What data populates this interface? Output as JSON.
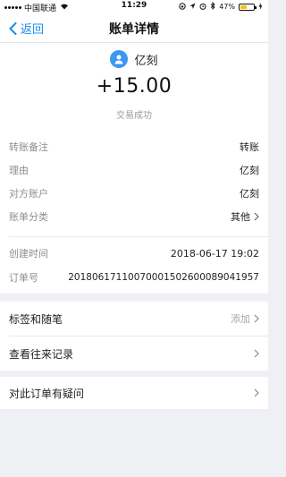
{
  "status_bar": {
    "carrier": "中国联通",
    "time": "11:29",
    "battery_percent": "47%",
    "battery_level": 0.47,
    "icons": [
      "signal-dots-icon",
      "wifi-icon",
      "lock-rotation-icon",
      "location-icon",
      "alarm-icon",
      "bluetooth-icon",
      "battery-icon",
      "charging-icon"
    ]
  },
  "nav": {
    "back_label": "返回",
    "title": "账单详情"
  },
  "summary": {
    "payee_name": "亿刻",
    "amount": "+15.00",
    "status": "交易成功",
    "avatar_color": "#3b97ef"
  },
  "details": [
    {
      "label": "转账备注",
      "value": "转账"
    },
    {
      "label": "理由",
      "value": "亿刻"
    },
    {
      "label": "对方账户",
      "value": "亿刻"
    },
    {
      "label": "账单分类",
      "value": "其他"
    },
    {
      "label": "创建时间",
      "value": "2018-06-17 19:02"
    },
    {
      "label": "订单号",
      "value": "20180617110070001502600089041957"
    }
  ],
  "actions": {
    "tags_label": "标签和随笔",
    "tags_hint": "添加",
    "history_label": "查看往来记录",
    "question_label": "对此订单有疑问"
  },
  "colors": {
    "accent": "#1a8cf0",
    "background": "#eef0f3",
    "battery_fill": "#f4c20d"
  }
}
